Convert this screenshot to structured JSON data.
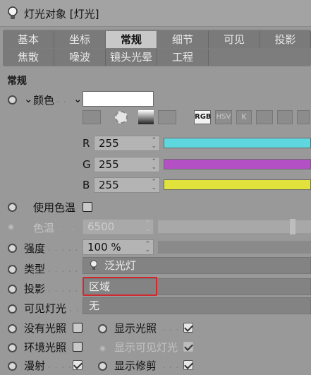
{
  "window": {
    "title": "灯光对象 [灯光]"
  },
  "tabs": {
    "row1": [
      "基本",
      "坐标",
      "常规",
      "细节",
      "可见",
      "投影"
    ],
    "row2": [
      "焦散",
      "噪波",
      "镜头光晕",
      "工程"
    ],
    "active": "常规"
  },
  "section_title": "常规",
  "color": {
    "label": "颜色",
    "value_hex": "#ffffff",
    "modes": [
      "RGB",
      "HSV",
      "K"
    ],
    "r_label": "R",
    "r_value": "255",
    "g_label": "G",
    "g_value": "255",
    "b_label": "B",
    "b_value": "255",
    "slider_colors": {
      "r": "#5ed8de",
      "g": "#b450c6",
      "b": "#e2e23c"
    }
  },
  "use_temperature": {
    "label": "使用色温",
    "checked": false
  },
  "temperature": {
    "label": "色温",
    "value": "6500"
  },
  "intensity": {
    "label": "强度",
    "value": "100 %"
  },
  "type": {
    "label": "类型",
    "value": "泛光灯"
  },
  "shadow": {
    "label": "投影",
    "value": "区域"
  },
  "visible_light": {
    "label": "可见灯光",
    "value": "无"
  },
  "options": {
    "no_illumination": {
      "label": "没有光照",
      "checked": false
    },
    "show_illumination": {
      "label": "显示光照",
      "checked": true
    },
    "ambient": {
      "label": "环境光照",
      "checked": false
    },
    "show_visible_light": {
      "label": "显示可见灯光",
      "checked": true
    },
    "diffuse": {
      "label": "漫射",
      "checked": true
    },
    "show_clipping": {
      "label": "显示修剪",
      "checked": true
    }
  },
  "accent_colors": {
    "highlight_box": "#d2282f",
    "active_tab": "#c8c8c8"
  }
}
